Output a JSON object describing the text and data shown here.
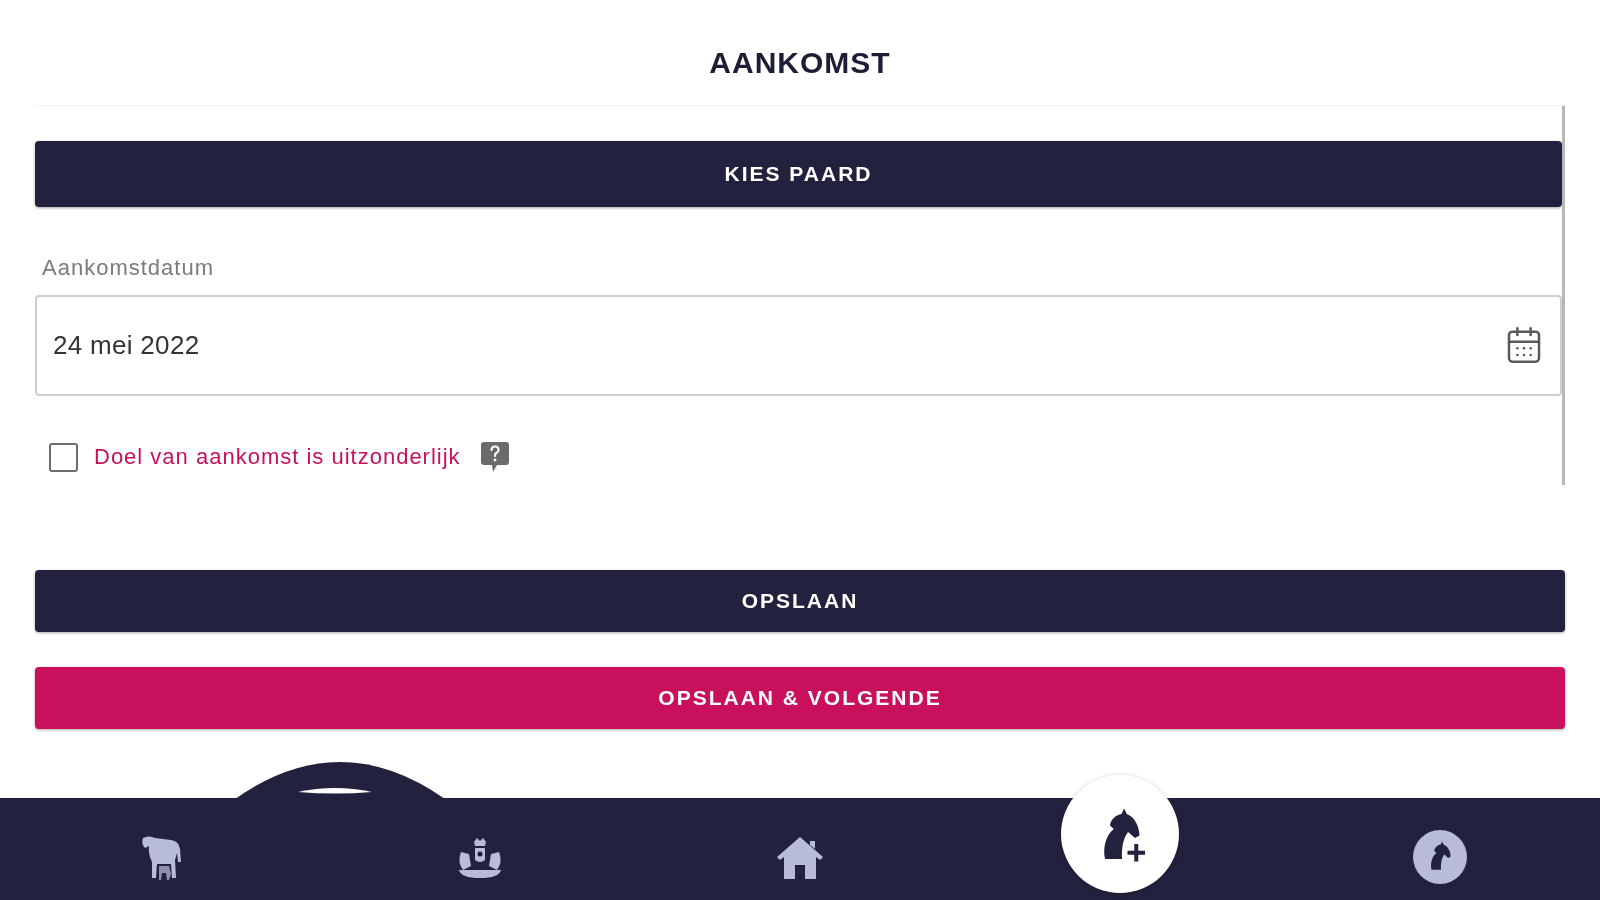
{
  "header": {
    "title": "AANKOMST"
  },
  "form": {
    "choose_horse_button": {
      "label": "KIES PAARD",
      "kind": "primary"
    },
    "arrival_date": {
      "label": "Aankomstdatum",
      "value": "24 mei 2022"
    },
    "exceptional_purpose": {
      "label": "Doel van aankomst is uitzonderlijk",
      "checked": false
    }
  },
  "actions": [
    {
      "label": "OPSLAAN",
      "kind": "primary"
    },
    {
      "label": "OPSLAAN & VOLGENDE",
      "kind": "accent"
    }
  ]
}
